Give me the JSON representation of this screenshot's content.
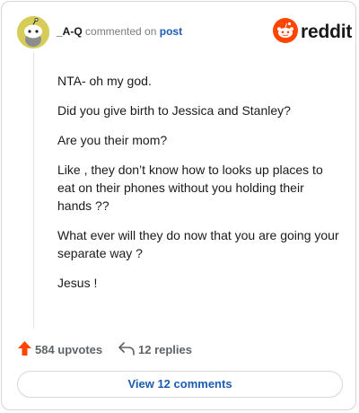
{
  "header": {
    "username": "_A-Q",
    "commented_text": "commented on",
    "post_link": "post",
    "brand": "reddit"
  },
  "comment": {
    "paragraphs": [
      "NTA- oh my god.",
      "Did you give birth to Jessica and Stanley?",
      "Are you their mom?",
      "Like , they don’t know how to looks up places to eat on their phones without you holding their hands ??",
      "What ever will they do now that you are going your separate way ?",
      "Jesus !"
    ]
  },
  "actions": {
    "upvotes": "584 upvotes",
    "replies": "12 replies"
  },
  "footer": {
    "view_comments": "View 12 comments"
  },
  "colors": {
    "brand_orange": "#ff4500",
    "link_blue": "#1c5bb0",
    "avatar_yellow": "#d6cc58"
  },
  "icons": [
    "snoo-avatar-icon",
    "reddit-logo-icon",
    "upvote-arrow-icon",
    "reply-arrow-icon"
  ]
}
